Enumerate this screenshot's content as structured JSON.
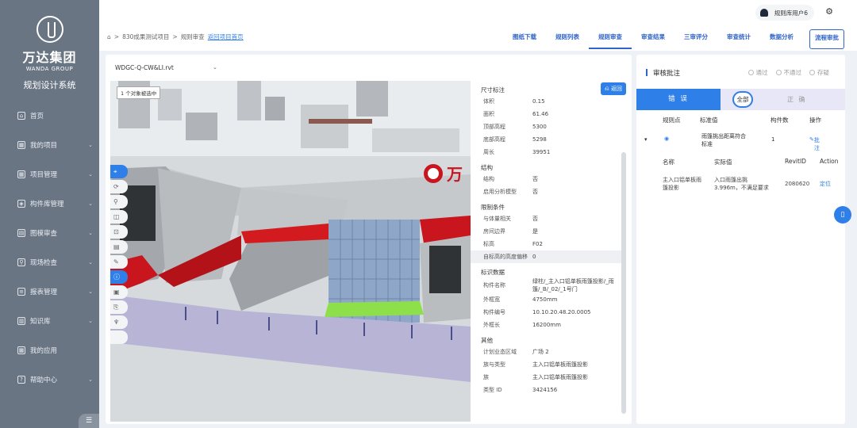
{
  "sidebar": {
    "brand_cn": "万达集团",
    "brand_en": "WANDA GROUP",
    "system_name": "规划设计系统",
    "items": [
      {
        "label": "首页",
        "icon": "home-icon",
        "expandable": false
      },
      {
        "label": "我的项目",
        "icon": "calendar-icon",
        "expandable": true
      },
      {
        "label": "项目管理",
        "icon": "calendar-icon",
        "expandable": true
      },
      {
        "label": "构件库管理",
        "icon": "cube-icon",
        "expandable": true
      },
      {
        "label": "图模审查",
        "icon": "document-icon",
        "expandable": true
      },
      {
        "label": "现场检查",
        "icon": "search-icon",
        "expandable": true
      },
      {
        "label": "报表管理",
        "icon": "list-icon",
        "expandable": true
      },
      {
        "label": "知识库",
        "icon": "book-icon",
        "expandable": true
      },
      {
        "label": "我的应用",
        "icon": "grid-icon",
        "expandable": false
      },
      {
        "label": "帮助中心",
        "icon": "help-icon",
        "expandable": true
      }
    ]
  },
  "header": {
    "user_name": "规则库用户6",
    "breadcrumb": [
      "830成果测试项目",
      "规则审查"
    ],
    "breadcrumb_link": "返回项目首页",
    "tabs": [
      {
        "label": "图纸下载",
        "active": false
      },
      {
        "label": "规则列表",
        "active": false
      },
      {
        "label": "规则审查",
        "active": true
      },
      {
        "label": "审查结果",
        "active": false
      },
      {
        "label": "三审评分",
        "active": false
      },
      {
        "label": "审查统计",
        "active": false
      },
      {
        "label": "数据分析",
        "active": false
      },
      {
        "label": "流程审批",
        "active": false
      }
    ]
  },
  "viewer": {
    "file_name": "WDGC-Q-CW&LI.rvt",
    "selection_tip": "1 个对象被选中",
    "back_label": "返回"
  },
  "properties": [
    {
      "section": "尺寸标注",
      "rows": [
        [
          "体积",
          "0.15"
        ],
        [
          "面积",
          "61.46"
        ],
        [
          "顶部高程",
          "5300"
        ],
        [
          "底部高程",
          "5298"
        ],
        [
          "周长",
          "39951"
        ]
      ]
    },
    {
      "section": "结构",
      "rows": [
        [
          "结构",
          "否"
        ],
        [
          "启用分析模型",
          "否"
        ]
      ]
    },
    {
      "section": "限制条件",
      "rows": [
        [
          "与体量相关",
          "否"
        ],
        [
          "房间边界",
          "是"
        ],
        [
          "标高",
          "F02"
        ],
        [
          "自标高的高度偏移",
          "0"
        ]
      ]
    },
    {
      "section": "标识数据",
      "rows": [
        [
          "构件名称",
          "绿柱/_主入口铝单板雨篷投影/_雨篷/_B/_02/_1号门"
        ],
        [
          "外框宽",
          "4750mm"
        ],
        [
          "构件编号",
          "10.10.20.48.20.0005"
        ],
        [
          "外框长",
          "16200mm"
        ]
      ]
    },
    {
      "section": "其他",
      "rows": [
        [
          "计划业态区域",
          "广场 2"
        ],
        [
          "族与类型",
          "主入口铝单板雨篷投影"
        ],
        [
          "族",
          "主入口铝单板雨篷投影"
        ],
        [
          "类型 ID",
          "3424156"
        ]
      ]
    }
  ],
  "review": {
    "title": "审核批注",
    "options": [
      "通过",
      "不通过",
      "存疑"
    ],
    "seg_error": "错 误",
    "seg_all": "全部",
    "seg_correct": "正 确",
    "columns": [
      "规则点",
      "标准值",
      "构件数",
      "操作"
    ],
    "row": {
      "standard": "雨篷挑出距离符合标准",
      "count": "1",
      "action": "批注"
    },
    "sub_columns": [
      "名称",
      "实际值",
      "RevitID",
      "Action"
    ],
    "sub_row": {
      "name": "主入口铝单板雨篷投影",
      "actual": "入口雨篷出挑3.996m，不满足要求",
      "revit_id": "2080620",
      "action": "定位"
    }
  }
}
